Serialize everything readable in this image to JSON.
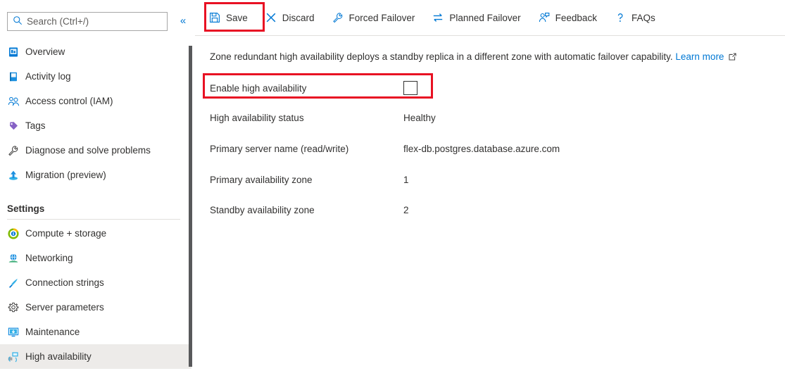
{
  "sidebar": {
    "search": {
      "placeholder": "Search (Ctrl+/)",
      "value": "",
      "icon": "search-icon"
    },
    "collapse_glyph": "«",
    "items": [
      {
        "label": "Overview",
        "icon": "overview-icon",
        "selected": false
      },
      {
        "label": "Activity log",
        "icon": "activity-log-icon",
        "selected": false
      },
      {
        "label": "Access control (IAM)",
        "icon": "access-control-icon",
        "selected": false
      },
      {
        "label": "Tags",
        "icon": "tag-icon",
        "selected": false
      },
      {
        "label": "Diagnose and solve problems",
        "icon": "wrench-icon",
        "selected": false
      },
      {
        "label": "Migration (preview)",
        "icon": "migration-icon",
        "selected": false
      }
    ],
    "section_label": "Settings",
    "settings_items": [
      {
        "label": "Compute + storage",
        "icon": "compute-storage-icon",
        "selected": false
      },
      {
        "label": "Networking",
        "icon": "networking-icon",
        "selected": false
      },
      {
        "label": "Connection strings",
        "icon": "connection-strings-icon",
        "selected": false
      },
      {
        "label": "Server parameters",
        "icon": "gear-icon",
        "selected": false
      },
      {
        "label": "Maintenance",
        "icon": "maintenance-icon",
        "selected": false
      },
      {
        "label": "High availability",
        "icon": "high-availability-icon",
        "selected": true
      }
    ]
  },
  "toolbar": {
    "buttons": [
      {
        "label": "Save",
        "icon": "save-icon"
      },
      {
        "label": "Discard",
        "icon": "discard-icon"
      },
      {
        "label": "Forced Failover",
        "icon": "wrench-icon"
      },
      {
        "label": "Planned Failover",
        "icon": "swap-icon"
      },
      {
        "label": "Feedback",
        "icon": "feedback-icon"
      },
      {
        "label": "FAQs",
        "icon": "question-icon"
      }
    ]
  },
  "main": {
    "intro_text": "Zone redundant high availability deploys a standby replica in a different zone with automatic failover capability.",
    "learn_more_label": "Learn more",
    "learn_more_icon": "external-link-icon",
    "enable_ha": {
      "label": "Enable high availability",
      "checked": false
    },
    "fields": [
      {
        "label": "High availability status",
        "value": "Healthy"
      },
      {
        "label": "Primary server name (read/write)",
        "value": "flex-db.postgres.database.azure.com"
      },
      {
        "label": "Primary availability zone",
        "value": "1"
      },
      {
        "label": "Standby availability zone",
        "value": "2"
      }
    ]
  },
  "colors": {
    "accent": "#0078d4",
    "highlight": "#e81123",
    "selected_row": "#edebe9",
    "text": "#323130",
    "border": "#e1dfdd"
  }
}
